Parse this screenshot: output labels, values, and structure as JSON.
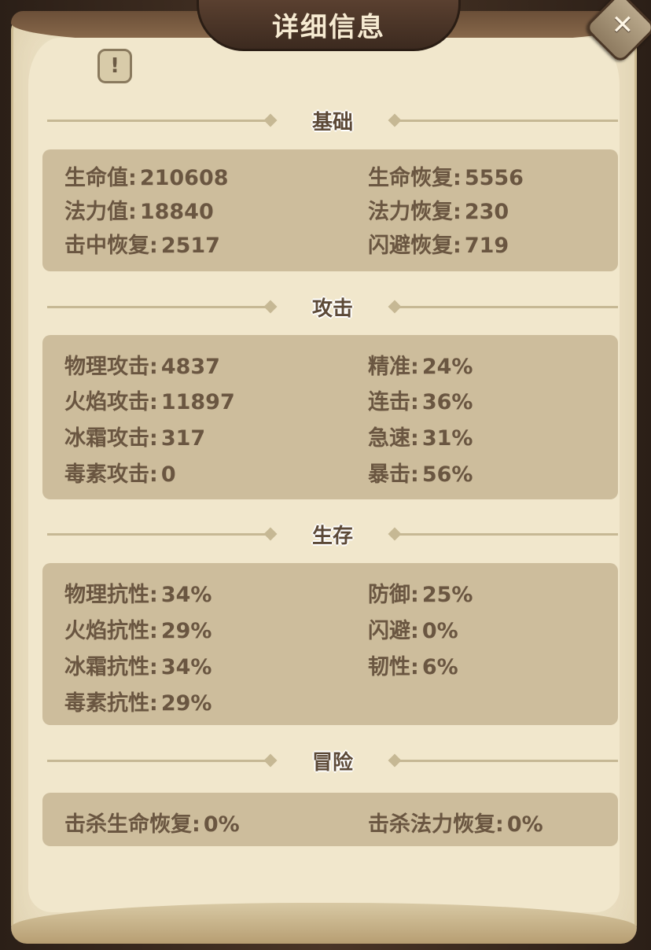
{
  "title": "详细信息",
  "close_icon": "✕",
  "info_icon": "!",
  "sections": [
    {
      "label": "基础",
      "left": [
        {
          "name": "生命值",
          "value": "210608"
        },
        {
          "name": "法力值",
          "value": "18840"
        },
        {
          "name": "击中恢复",
          "value": "2517"
        }
      ],
      "right": [
        {
          "name": "生命恢复",
          "value": "5556"
        },
        {
          "name": "法力恢复",
          "value": "230"
        },
        {
          "name": "闪避恢复",
          "value": "719"
        }
      ]
    },
    {
      "label": "攻击",
      "left": [
        {
          "name": "物理攻击",
          "value": "4837"
        },
        {
          "name": "火焰攻击",
          "value": "11897"
        },
        {
          "name": "冰霜攻击",
          "value": "317"
        },
        {
          "name": "毒素攻击",
          "value": "0"
        }
      ],
      "right": [
        {
          "name": "精准",
          "value": "24%"
        },
        {
          "name": "连击",
          "value": "36%"
        },
        {
          "name": "急速",
          "value": "31%"
        },
        {
          "name": "暴击",
          "value": "56%"
        }
      ]
    },
    {
      "label": "生存",
      "left": [
        {
          "name": "物理抗性",
          "value": "34%"
        },
        {
          "name": "火焰抗性",
          "value": "29%"
        },
        {
          "name": "冰霜抗性",
          "value": "34%"
        },
        {
          "name": "毒素抗性",
          "value": "29%"
        }
      ],
      "right": [
        {
          "name": "防御",
          "value": "25%"
        },
        {
          "name": "闪避",
          "value": "0%"
        },
        {
          "name": "韧性",
          "value": "6%"
        }
      ]
    },
    {
      "label": "冒险",
      "left": [
        {
          "name": "击杀生命恢复",
          "value": "0%"
        }
      ],
      "right": [
        {
          "name": "击杀法力恢复",
          "value": "0%"
        }
      ]
    }
  ]
}
